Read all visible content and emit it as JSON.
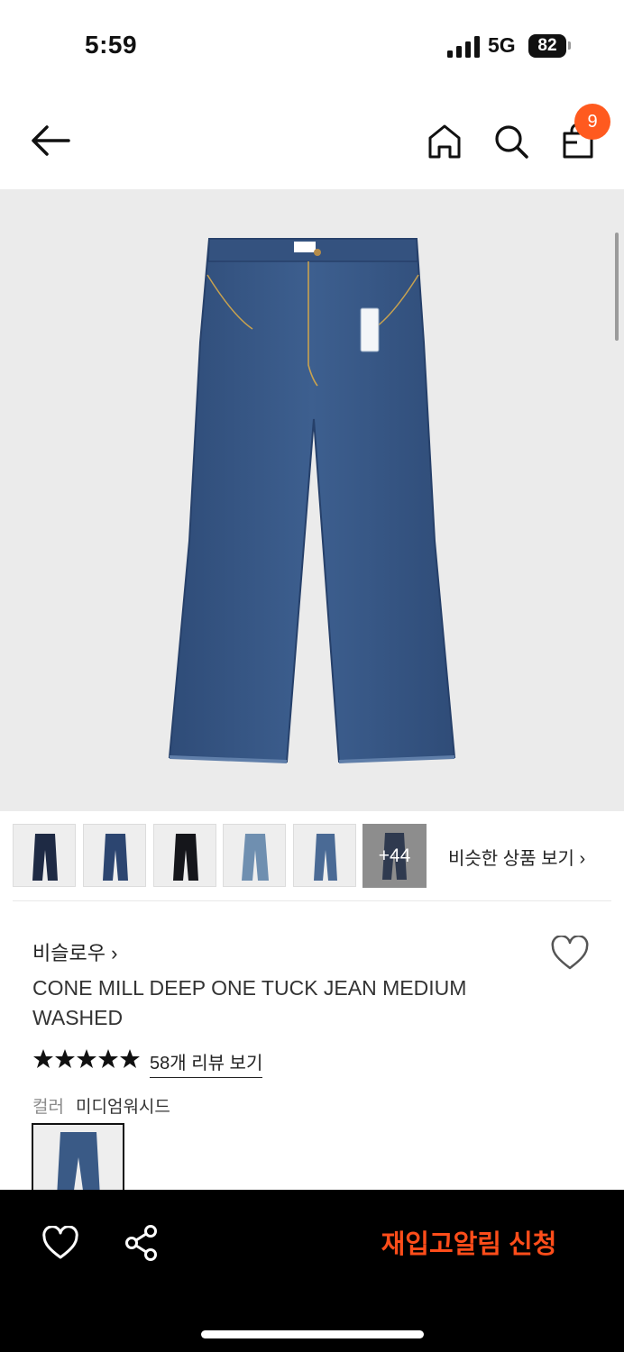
{
  "status_bar": {
    "time": "5:59",
    "network": "5G",
    "battery": "82"
  },
  "header": {
    "cart_count": "9"
  },
  "thumbnails": {
    "more_count": "+44",
    "similar_label": "비슷한 상품 보기 ›"
  },
  "product": {
    "brand": "비슬로우 ›",
    "title": "CONE MILL DEEP ONE TUCK JEAN MEDIUM WASHED",
    "rating_stars": 5,
    "review_link": "58개 리뷰 보기",
    "color_label": "컬러",
    "color_value": "미디엄워시드"
  },
  "bottom_bar": {
    "restock_label": "재입고알림 신청"
  },
  "colors": {
    "accent": "#ff5a1f",
    "restock_text": "#ff4d1a",
    "denim": "#3a5a86",
    "hero_bg": "#ebebeb"
  }
}
